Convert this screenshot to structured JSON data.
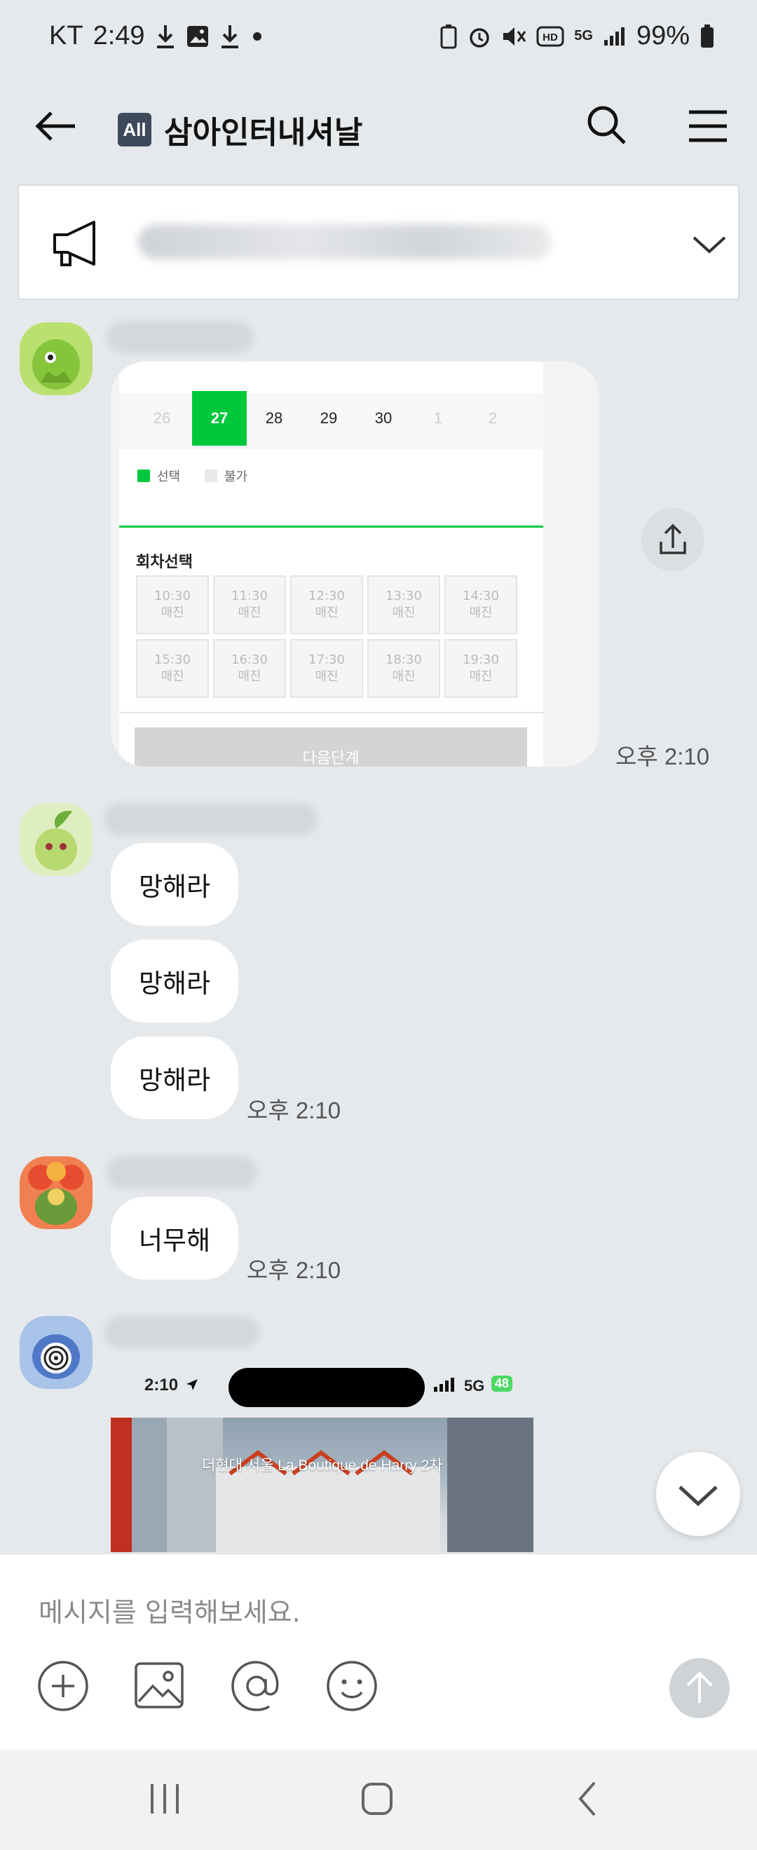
{
  "status_bar": {
    "carrier": "KT",
    "time": "2:49",
    "battery": "99%",
    "network": "5G"
  },
  "header": {
    "badge": "All",
    "title": "삼아인터내셔날"
  },
  "calendar_card": {
    "dates": [
      {
        "label": "26",
        "state": "dim"
      },
      {
        "label": "27",
        "state": "selected"
      },
      {
        "label": "28",
        "state": "normal"
      },
      {
        "label": "29",
        "state": "normal"
      },
      {
        "label": "30",
        "state": "normal"
      },
      {
        "label": "1",
        "state": "dim"
      },
      {
        "label": "2",
        "state": "dim"
      }
    ],
    "legend_selected": "선택",
    "legend_unavailable": "불가",
    "section_title": "회차선택",
    "slots": [
      {
        "time": "10:30",
        "status": "매진"
      },
      {
        "time": "11:30",
        "status": "매진"
      },
      {
        "time": "12:30",
        "status": "매진"
      },
      {
        "time": "13:30",
        "status": "매진"
      },
      {
        "time": "14:30",
        "status": "매진"
      },
      {
        "time": "15:30",
        "status": "매진"
      },
      {
        "time": "16:30",
        "status": "매진"
      },
      {
        "time": "17:30",
        "status": "매진"
      },
      {
        "time": "18:30",
        "status": "매진"
      },
      {
        "time": "19:30",
        "status": "매진"
      }
    ],
    "next_button": "다음단계",
    "time": "오후 2:10"
  },
  "messages": [
    {
      "text": "망해라"
    },
    {
      "text": "망해라"
    },
    {
      "text": "망해라",
      "time": "오후 2:10"
    },
    {
      "text": "너무해",
      "time": "오후 2:10"
    }
  ],
  "screenshot_preview": {
    "time": "2:10",
    "network": "5G",
    "battery": "48",
    "caption": "더현대 서울 La Boutique de Harry 2차"
  },
  "input": {
    "placeholder": "메시지를 입력해보세요."
  },
  "colors": {
    "background": "#e6e9ec",
    "accent_green": "#00c73c",
    "badge": "#3e4a5c"
  }
}
